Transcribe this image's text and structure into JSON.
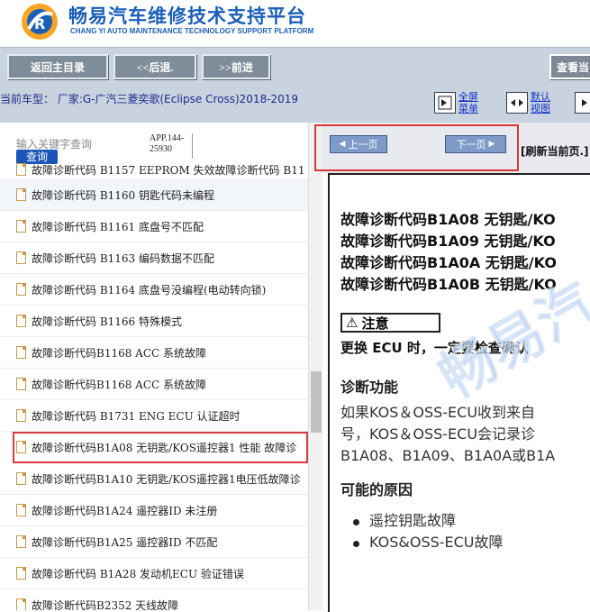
{
  "header": {
    "title": "畅易汽车维修技术支持平台",
    "subtitle": "CHANG YI AUTO MAINTENANCE TECHNOLOGY SUPPORT PLATFORM"
  },
  "toolbar": {
    "home": "返回主目录",
    "back": "<<后退.",
    "forward": ">>前进",
    "view_current": "查看当"
  },
  "vehicle": {
    "text": "当前车型：  厂家:G-广汽三菱奕歌(Eclipse Cross)2018-2019",
    "fullscreen_line1": "全屏",
    "fullscreen_line2": "菜单",
    "default_line1": "默认",
    "default_line2": "视图"
  },
  "search": {
    "placeholder": "输入关键字查询",
    "button": "查询",
    "app_code_line1": "APP.144-",
    "app_code_line2": "25930"
  },
  "list": {
    "items": [
      "故障诊断代码 B1157 EEPROM 失效故障诊断代码 B11",
      "故障诊断代码 B1160 钥匙代码未编程",
      "故障诊断代码 B1161 底盘号不匹配",
      "故障诊断代码 B1163 编码数据不匹配",
      "故障诊断代码 B1164 底盘号没编程(电动转向锁)",
      "故障诊断代码 B1166 特殊模式",
      "故障诊断代码B1168 ACC 系统故障",
      "故障诊断代码B1168 ACC 系统故障",
      "故障诊断代码 B1731 ENG ECU 认证超时",
      "故障诊断代码B1A08 无钥匙/KOS遥控器1 性能 故障诊",
      "故障诊断代码B1A10 无钥匙/KOS遥控器1电压低故障诊",
      "故障诊断代码B1A24 遥控器ID 未注册",
      "故障诊断代码B1A25 遥控器ID 不匹配",
      "故障诊断代码 B1A28 发动机ECU 验证错误",
      "故障诊断代码B2352 天线故障"
    ]
  },
  "page_nav": {
    "prev": "上一页",
    "next": "下一页",
    "refresh": "[刷新当前页.]"
  },
  "doc": {
    "titles": [
      "故障诊断代码B1A08 无钥匙/KO",
      "故障诊断代码B1A09 无钥匙/KO",
      "故障诊断代码B1A0A 无钥匙/KO",
      "故障诊断代码B1A0B 无钥匙/KO"
    ],
    "caution": "注意",
    "caution_text": "更换 ECU 时，一定要检查确认",
    "diag_heading": "诊断功能",
    "diag_lines": [
      "如果KOS＆OSS-ECU收到来自",
      "号，KOS＆OSS-ECU会记录诊",
      "B1A08、B1A09、B1A0A或B1A"
    ],
    "causes_heading": "可能的原因",
    "causes": [
      "遥控钥匙故障",
      "KOS&OSS-ECU故障"
    ],
    "watermark": "畅易汽"
  },
  "colors": {
    "brand": "#1c5fb7",
    "toolbar_bg": "#c9d3df",
    "highlight": "#d63a3a"
  }
}
